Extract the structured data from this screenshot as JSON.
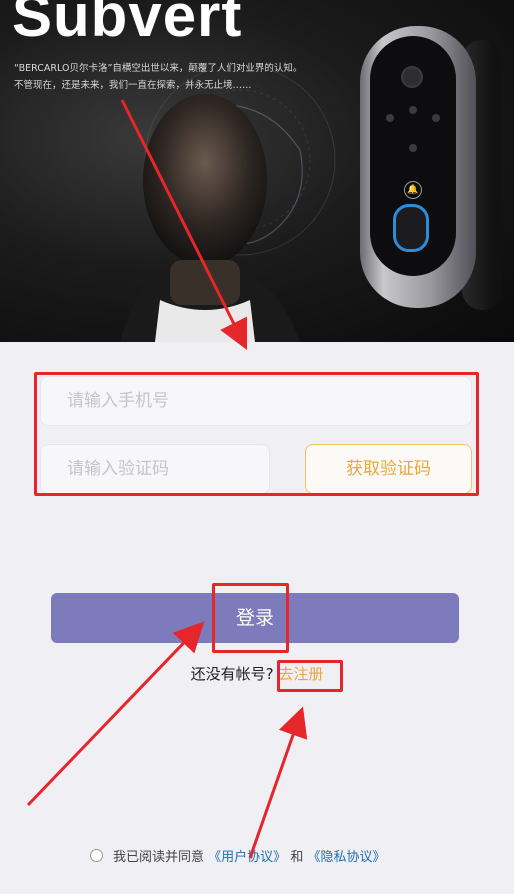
{
  "hero": {
    "brand": "Subvert",
    "tagline_line1": "“BERCARLO贝尔卡洛”自横空出世以来，颠覆了人们对业界的认知。",
    "tagline_line2": "不管现在，还是未来，我们一直在探索，并永无止境……"
  },
  "form": {
    "phone_placeholder": "请输入手机号",
    "code_placeholder": "请输入验证码",
    "get_code_label": "获取验证码",
    "login_label": "登录",
    "no_account_text": "还没有帐号?",
    "register_label": "去注册"
  },
  "agreement": {
    "prefix": "我已阅读并同意",
    "user_agreement": "《用户协议》",
    "and": "和",
    "privacy_agreement": "《隐私协议》",
    "checked": false
  },
  "colors": {
    "primary_button": "#7e7bbd",
    "accent_orange": "#e8a83a",
    "link_blue": "#1f6fb0",
    "annotation_red": "#e5262a",
    "background": "#efeff4"
  }
}
